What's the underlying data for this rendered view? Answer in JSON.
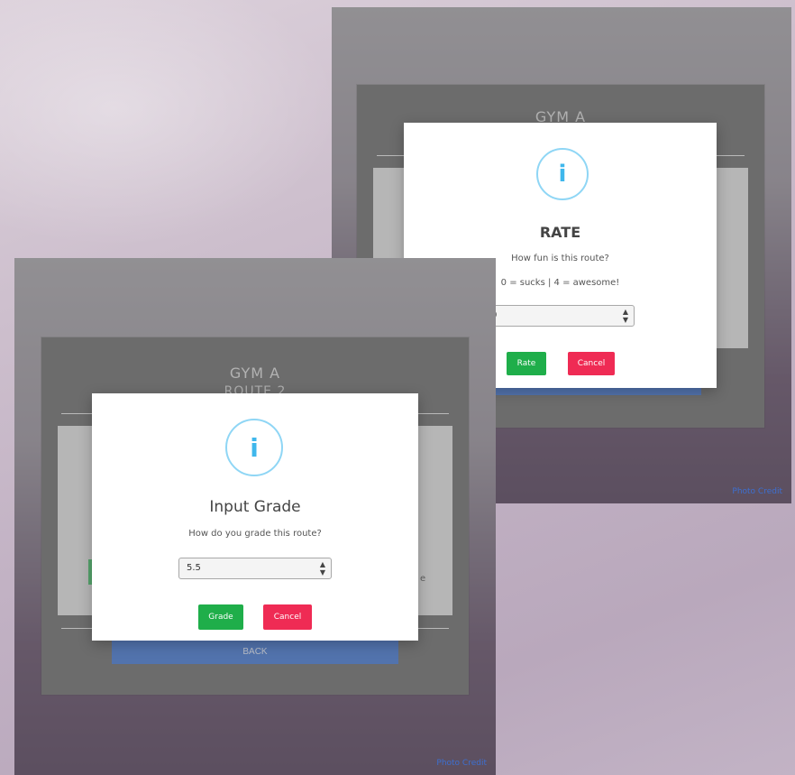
{
  "screenshots": {
    "rate": {
      "card": {
        "gym": "GYM A",
        "back_label": ""
      },
      "modal": {
        "icon": "info-icon",
        "icon_glyph": "i",
        "title": "RATE",
        "question": "How fun is this route?",
        "scale": "0 = sucks | 4 = awesome!",
        "select_value": "0",
        "ok_label": "Rate",
        "cancel_label": "Cancel"
      },
      "credits": "Photo Credit"
    },
    "grade": {
      "card": {
        "gym": "GYM A",
        "route": "ROUTE 2",
        "side_text": "e",
        "back_label": "BACK"
      },
      "modal": {
        "icon": "info-icon",
        "icon_glyph": "i",
        "title": "Input Grade",
        "question": "How do you grade this route?",
        "select_value": "5.5",
        "ok_label": "Grade",
        "cancel_label": "Cancel"
      },
      "credits": "Photo Credit"
    }
  },
  "colors": {
    "ok_green": "#1fae4a",
    "cancel_red": "#ef2b54",
    "back_blue": "#1b57c0",
    "info_blue": "#3fb7ec"
  }
}
